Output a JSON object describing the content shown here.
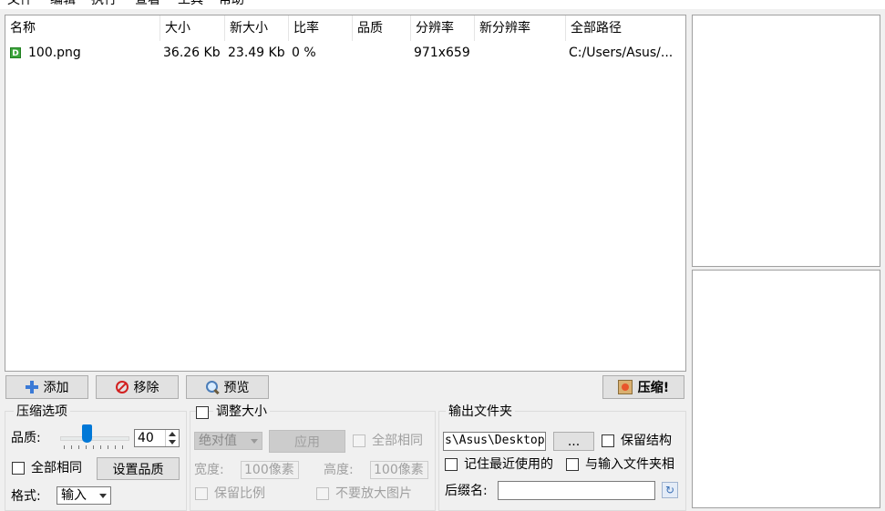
{
  "menu": [
    "文件",
    "编辑",
    "执行",
    "查看",
    "工具",
    "帮助"
  ],
  "file_list": {
    "columns": [
      "名称",
      "大小",
      "新大小",
      "比率",
      "品质",
      "分辨率",
      "新分辨率",
      "全部路径"
    ],
    "rows": [
      {
        "name": "100.png",
        "size": "36.26 Kb",
        "new_size": "23.49 Kb",
        "ratio": "0 %",
        "quality": "",
        "resolution": "971x659",
        "new_resolution": "",
        "path": "C:/Users/Asus/..."
      }
    ],
    "row_icon": "D"
  },
  "toolbar": {
    "add": "添加",
    "remove": "移除",
    "preview": "预览",
    "compress": "压缩!"
  },
  "compress_options": {
    "title": "压缩选项",
    "quality_label": "品质:",
    "quality_value": "40",
    "quality_fraction": 0.4,
    "all_same": "全部相同",
    "set_quality": "设置品质",
    "format_label": "格式:",
    "format_value": "输入"
  },
  "resize": {
    "title": "调整大小",
    "mode": "绝对值",
    "apply": "应用",
    "all_same": "全部相同",
    "width_label": "宽度:",
    "width_value": "100像素",
    "height_label": "高度:",
    "height_value": "100像素",
    "keep_ratio": "保留比例",
    "no_enlarge": "不要放大图片"
  },
  "output": {
    "title": "输出文件夹",
    "folder": "s\\Asus\\Desktop",
    "browse": "...",
    "keep_structure": "保留结构",
    "remember_last": "记住最近使用的",
    "same_as_input": "与输入文件夹相",
    "suffix_label": "后缀名:",
    "suffix_value": ""
  }
}
